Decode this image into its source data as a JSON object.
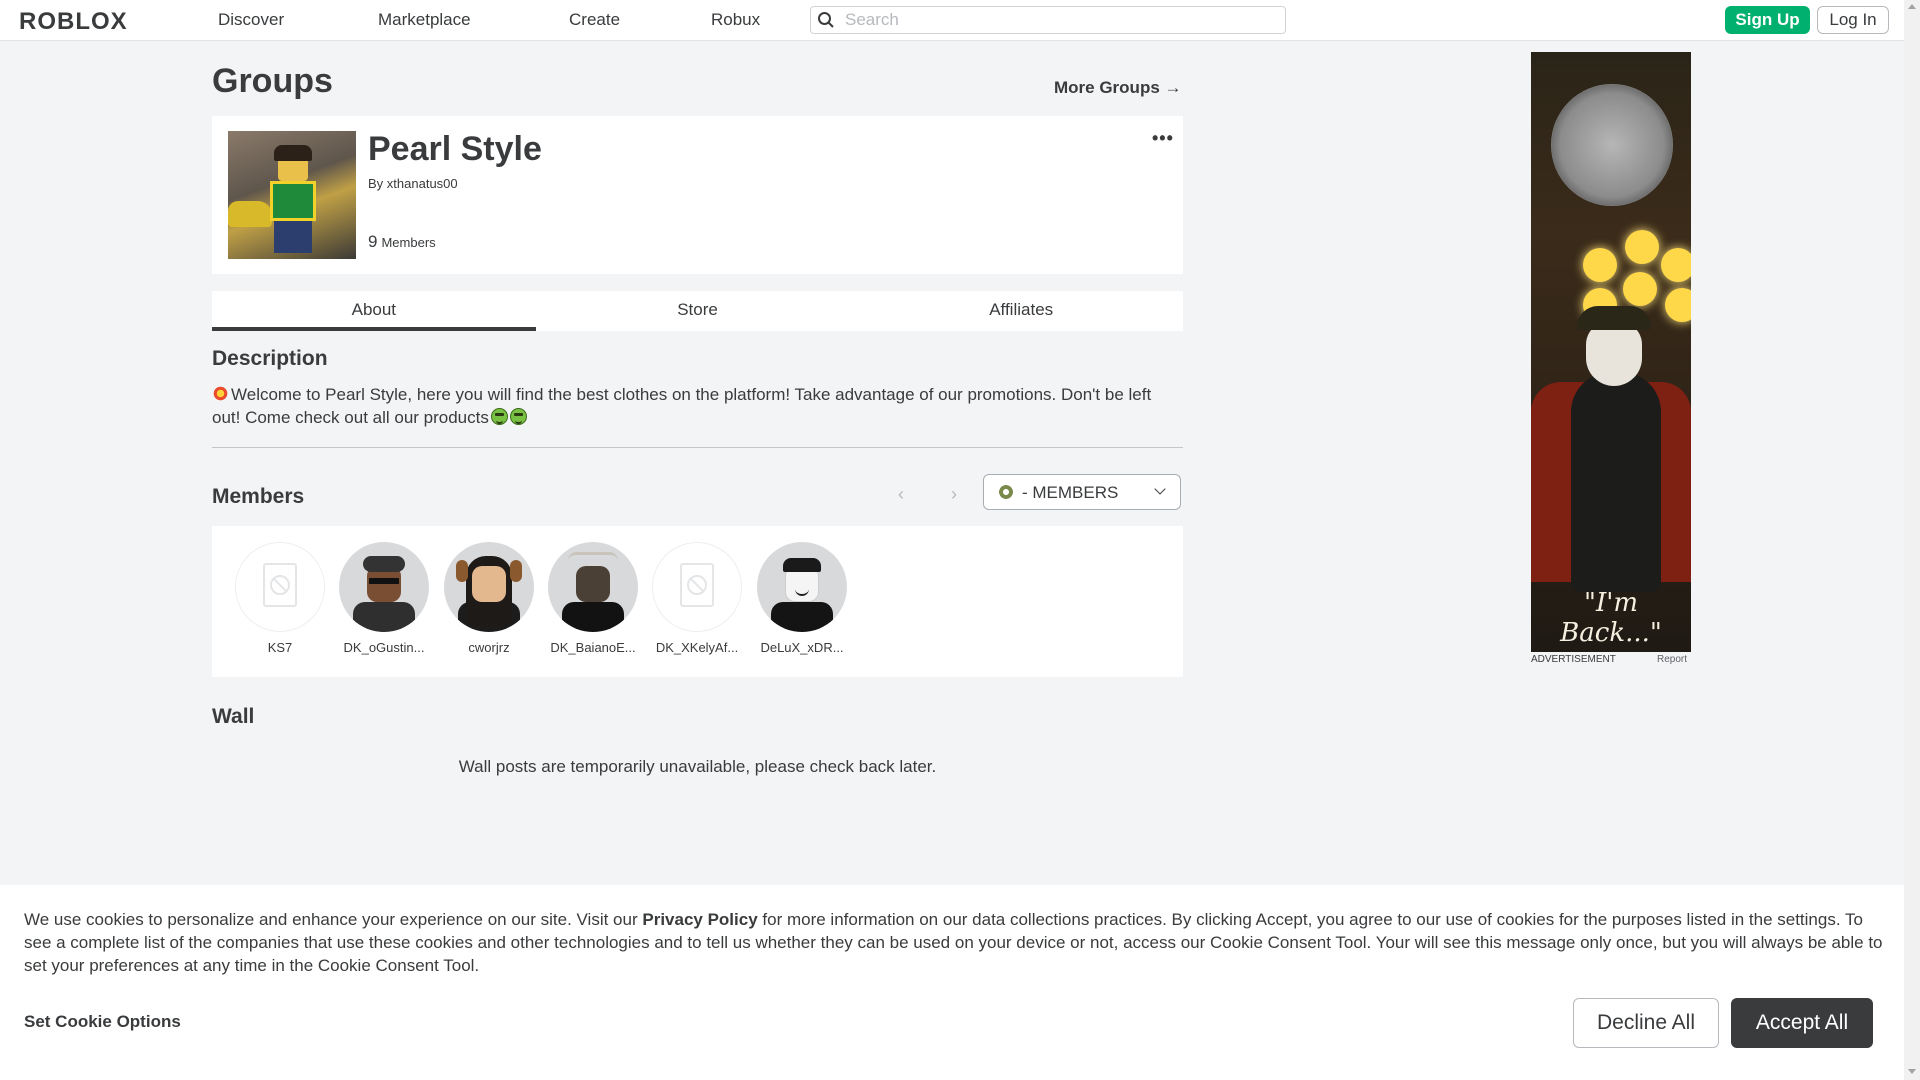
{
  "nav": {
    "logo": "ROBLOX",
    "links": [
      "Discover",
      "Marketplace",
      "Create",
      "Robux"
    ],
    "search_placeholder": "Search",
    "signup": "Sign Up",
    "login": "Log In"
  },
  "page": {
    "title": "Groups",
    "more_groups": "More Groups →"
  },
  "group": {
    "name": "Pearl Style",
    "by_label": "By",
    "owner": "xthanatus00",
    "member_count": "9",
    "member_label": "Members",
    "more_icon": "•••"
  },
  "tabs": [
    {
      "label": "About",
      "active": true
    },
    {
      "label": "Store",
      "active": false
    },
    {
      "label": "Affiliates",
      "active": false
    }
  ],
  "description": {
    "heading": "Description",
    "text_part1": "Welcome to Pearl Style, here you will find the best clothes on the platform! Take advantage of our promotions. Don't be left out! Come check out all our products"
  },
  "members": {
    "heading": "Members",
    "prev_icon": "‹",
    "next_icon": "›",
    "role_selected": "- MEMBERS",
    "list": [
      {
        "name": "KS7",
        "avatar": "blocked"
      },
      {
        "name": "DK_oGustin...",
        "avatar": "face"
      },
      {
        "name": "cworjrz",
        "avatar": "face"
      },
      {
        "name": "DK_BaianoE...",
        "avatar": "face"
      },
      {
        "name": "DK_XKelyAf...",
        "avatar": "blocked"
      },
      {
        "name": "DeLuX_xDR...",
        "avatar": "face"
      }
    ]
  },
  "wall": {
    "heading": "Wall",
    "message": "Wall posts are temporarily unavailable, please check back later."
  },
  "ad": {
    "caption": "\"I'm Back...\"",
    "label": "ADVERTISEMENT",
    "report": "Report"
  },
  "cookie": {
    "text_before": "We use cookies to personalize and enhance your experience on our site. Visit our ",
    "privacy_link": "Privacy Policy",
    "text_after": " for more information on our data collections practices. By clicking Accept, you agree to our use of cookies for the purposes listed in the settings. To see a complete list of the companies that use these cookies and other technologies and to tell us whether they can be used on your device or not, access our Cookie Consent Tool. Your will see this message only once, but you will always be able to set your preferences at any time in the Cookie Consent Tool.",
    "set_options": "Set Cookie Options",
    "decline": "Decline All",
    "accept": "Accept All"
  },
  "colors": {
    "accent_green": "#00b06f",
    "text": "#393b3d",
    "page_bg": "#f2f4f5"
  }
}
